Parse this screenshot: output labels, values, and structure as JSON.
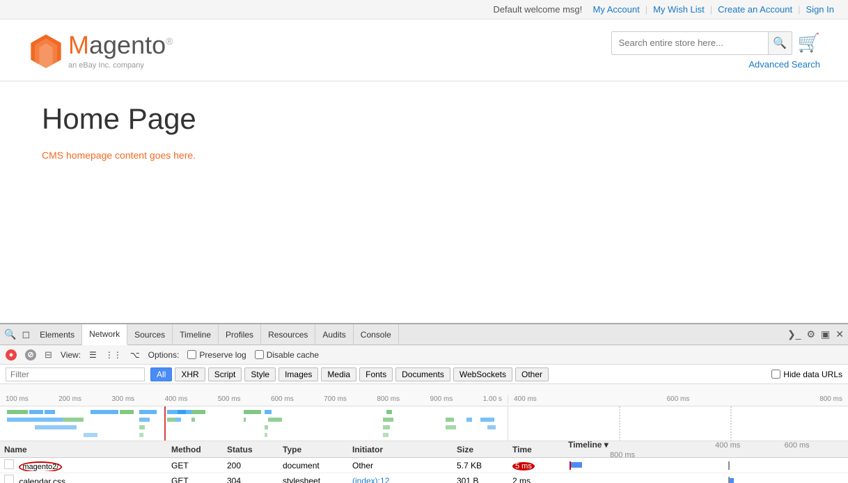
{
  "topbar": {
    "welcome": "Default welcome msg!",
    "my_account": "My Account",
    "my_wish_list": "My Wish List",
    "create_account": "Create an Account",
    "sign_in": "Sign In"
  },
  "header": {
    "logo_brand": "Magento",
    "logo_sub": "an eBay Inc. company",
    "search_placeholder": "Search entire store here...",
    "advanced_search": "Advanced Search"
  },
  "main": {
    "page_title": "Home Page",
    "cms_content": "CMS homepage content goes here."
  },
  "devtools": {
    "tabs": [
      "Elements",
      "Network",
      "Sources",
      "Timeline",
      "Profiles",
      "Resources",
      "Audits",
      "Console"
    ],
    "active_tab": "Network",
    "options": {
      "view_label": "View:",
      "options_label": "Options:",
      "preserve_log": "Preserve log",
      "disable_cache": "Disable cache"
    },
    "filter_placeholder": "Filter",
    "filter_buttons": [
      "All",
      "XHR",
      "Script",
      "Style",
      "Images",
      "Media",
      "Fonts",
      "Documents",
      "WebSockets",
      "Other"
    ],
    "hide_data_urls": "Hide data URLs",
    "timeline_marks_left": [
      "100 ms",
      "200 ms",
      "300 ms",
      "400 ms",
      "500 ms",
      "600 ms",
      "700 ms",
      "800 ms",
      "900 ms",
      "1.00 s"
    ],
    "timeline_marks_right": [
      "400 ms",
      "600 ms",
      "800 ms"
    ],
    "table": {
      "headers": [
        "Name",
        "Method",
        "Status",
        "Type",
        "Initiator",
        "Size",
        "Time",
        "Timeline"
      ],
      "rows": [
        {
          "name": "magento2/",
          "method": "GET",
          "status": "200",
          "type": "document",
          "initiator": "Other",
          "size": "5.7 KB",
          "time": "5 ms",
          "highlighted": true
        },
        {
          "name": "calendar.css",
          "method": "GET",
          "status": "304",
          "type": "stylesheet",
          "initiator": "(index):12",
          "size": "301 B",
          "time": "2 ms",
          "highlighted": false
        }
      ]
    }
  }
}
